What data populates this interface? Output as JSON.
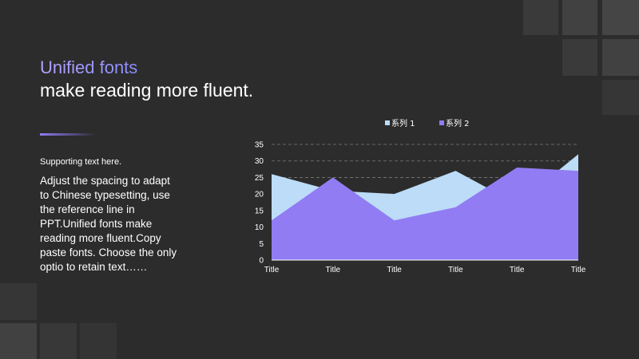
{
  "slide": {
    "title_line1": "Unified fonts",
    "title_line2": "make reading more fluent.",
    "supporting_text": "Supporting text here.",
    "body_text": "Adjust the spacing to adapt to Chinese typesetting, use the reference line in PPT.Unified fonts make reading more fluent.Copy paste fonts. Choose the only optio to retain text……"
  },
  "colors": {
    "background": "#2c2c2c",
    "accent": "#8f7cf6",
    "series1": "#bcdcf8",
    "series2": "#917cf3"
  },
  "chart_data": {
    "type": "area",
    "categories": [
      "Title",
      "Title",
      "Title",
      "Title",
      "Title",
      "Title"
    ],
    "series": [
      {
        "name": "系列 1",
        "values": [
          26,
          21,
          20,
          27,
          17,
          32
        ]
      },
      {
        "name": "系列 2",
        "values": [
          12,
          25,
          12,
          16,
          28,
          27
        ]
      }
    ],
    "ylim": [
      0,
      35
    ],
    "yticks": [
      0,
      5,
      10,
      15,
      20,
      25,
      30,
      35
    ],
    "legend_position": "top",
    "grid": "dashed horizontal"
  }
}
